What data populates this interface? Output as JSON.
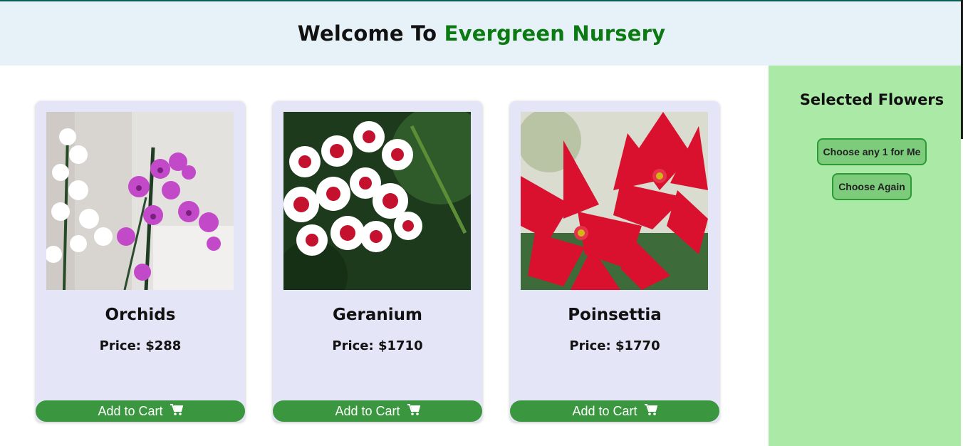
{
  "header": {
    "title_prefix": "Welcome To",
    "title_brand": "Evergreen Nursery"
  },
  "sidebar": {
    "title": "Selected Flowers",
    "buttons": {
      "random": "Choose any 1 for Me",
      "again": "Choose Again"
    }
  },
  "products": [
    {
      "name": "Orchids",
      "price": "Price: $288",
      "cart_label": "Add to Cart",
      "image_alt": "orchids-photo"
    },
    {
      "name": "Geranium",
      "price": "Price: $1710",
      "cart_label": "Add to Cart",
      "image_alt": "geranium-photo"
    },
    {
      "name": "Poinsettia",
      "price": "Price: $1770",
      "cart_label": "Add to Cart",
      "image_alt": "poinsettia-photo"
    }
  ],
  "colors": {
    "brand": "#0b7a12",
    "header_bg": "#e6f1f8",
    "sidebar_bg": "#aae9a6",
    "card_bg": "#e5e5f8",
    "cart_button": "#3a973f"
  }
}
